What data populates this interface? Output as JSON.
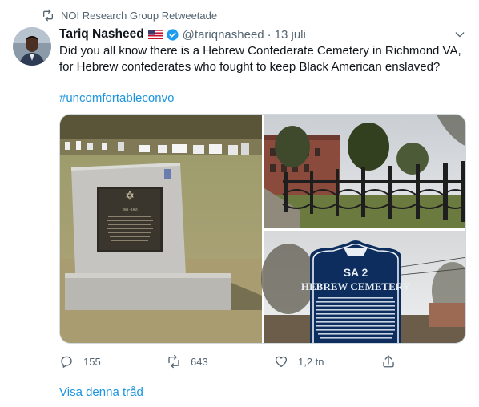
{
  "retweet": {
    "label": "NOI Research Group Retweetade",
    "icon": "retweet-icon"
  },
  "tweet": {
    "author_name": "Tariq Nasheed",
    "handle": "@tariqnasheed",
    "separator": "·",
    "date": "13 juli",
    "text": "Did you all know there is a Hebrew Confederate Cemetery in Richmond VA, for Hebrew confederates who fought to keep Black American enslaved?",
    "hashtag": "#uncomfortableconvo",
    "flag_icon": "us-flag-icon",
    "verified_icon": "verified-badge-icon"
  },
  "media": {
    "photo1": {
      "plaque_line1": "1861 - 1865"
    },
    "photo3": {
      "sign_code": "SA 2",
      "sign_title": "HEBREW CEMETERY",
      "sign_text": "Richmond's Hebrew Cemetery was established in the early 19th century by Congregation Beth Shalome, which was formed by 1789 and merged with Congregation Beth Ahabah in 1898. The cemetery was listed on the Virginia Landmarks Register and National Register of Historic Places in 2006. It is the oldest active Jewish cemetery in the South. Many leading Richmond merchants, civic leaders, and rabbis are interred here."
    }
  },
  "actions": {
    "reply_count": "155",
    "retweet_count": "643",
    "like_count": "1,2 tn"
  },
  "footer": {
    "show_thread": "Visa denna tråd"
  },
  "colors": {
    "link": "#1b95e0",
    "secondary": "#536471",
    "verified": "#1d9bf0"
  }
}
